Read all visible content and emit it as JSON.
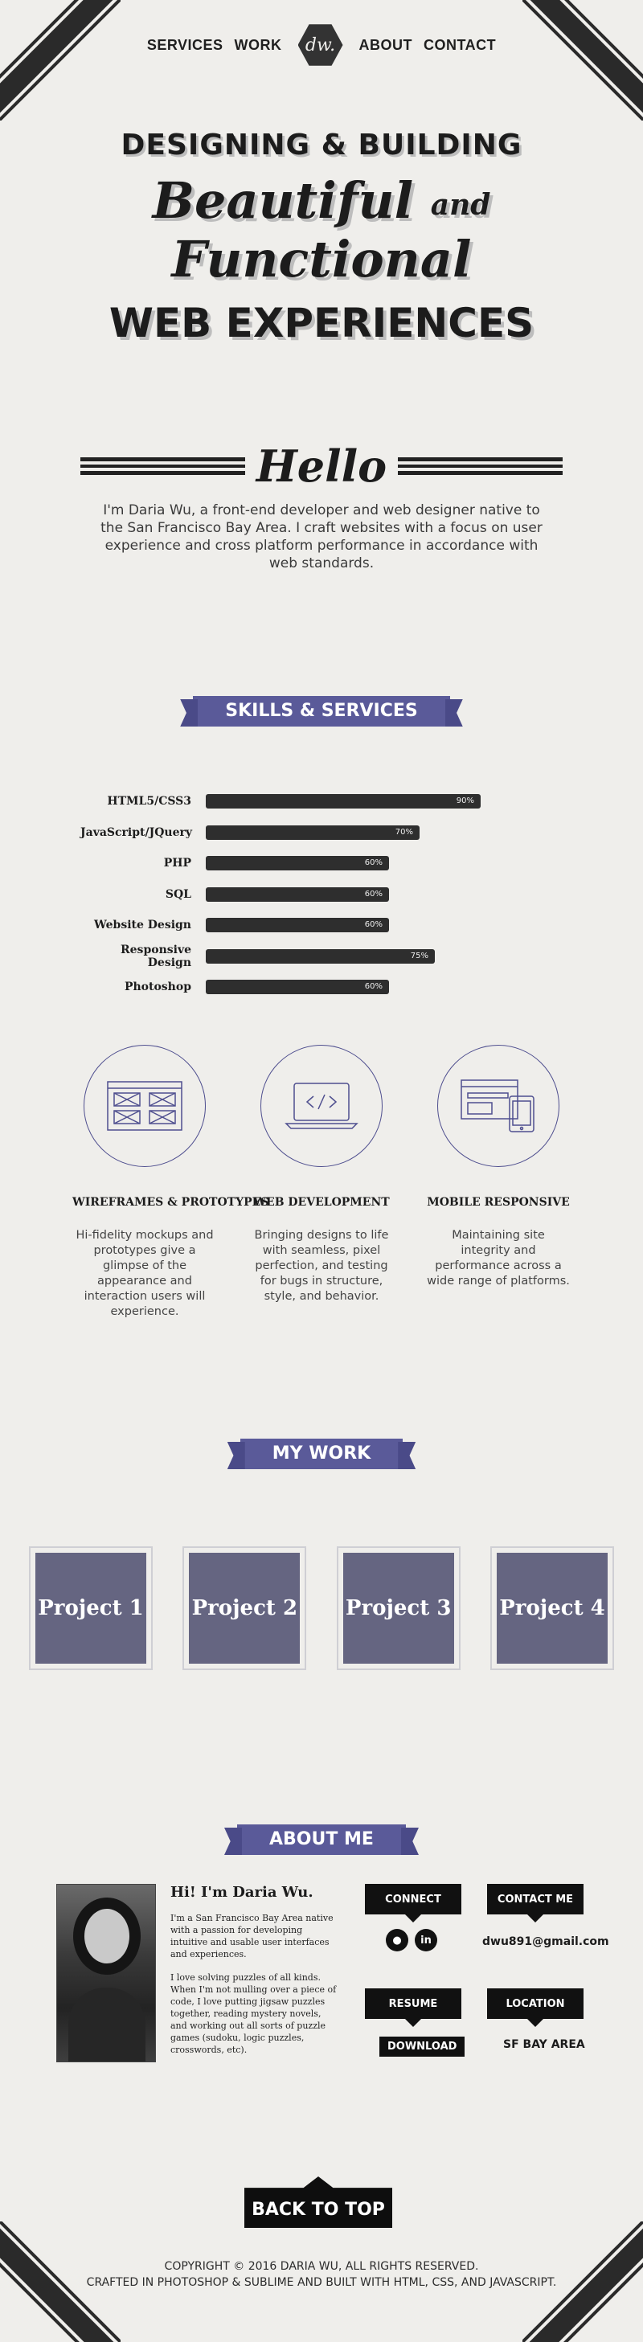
{
  "nav": {
    "items": [
      "SERVICES",
      "WORK",
      "ABOUT",
      "CONTACT"
    ],
    "logo_text": "dw."
  },
  "hero": {
    "line1": "DESIGNING & BUILDING",
    "line2_a": "Beautiful",
    "line2_and": "and",
    "line2_b": "Functional",
    "line3": "WEB EXPERIENCES"
  },
  "hello": {
    "title": "Hello",
    "text": "I'm Daria Wu, a front-end developer and web designer native to the San Francisco Bay Area. I craft websites with a focus on user experience and cross platform performance in accordance with web standards."
  },
  "skills": {
    "heading": "SKILLS & SERVICES",
    "items": [
      {
        "name": "HTML5/CSS3",
        "percent": 90,
        "label": "90%"
      },
      {
        "name": "JavaScript/JQuery",
        "percent": 70,
        "label": "70%"
      },
      {
        "name": "PHP",
        "percent": 60,
        "label": "60%"
      },
      {
        "name": "SQL",
        "percent": 60,
        "label": "60%"
      },
      {
        "name": "Website Design",
        "percent": 60,
        "label": "60%"
      },
      {
        "name": "Responsive Design",
        "percent": 75,
        "label": "75%"
      },
      {
        "name": "Photoshop",
        "percent": 60,
        "label": "60%"
      }
    ]
  },
  "services": [
    {
      "icon": "wireframe-icon",
      "title": "WIREFRAMES & PROTOTYPES",
      "text": "Hi-fidelity mockups and prototypes give a glimpse of the appearance and interaction users will experience."
    },
    {
      "icon": "code-laptop-icon",
      "title": "WEB DEVELOPMENT",
      "text": "Bringing designs to life with seamless, pixel perfection, and testing for bugs in structure, style, and behavior."
    },
    {
      "icon": "responsive-devices-icon",
      "title": "MOBILE RESPONSIVE",
      "text": "Maintaining site integrity and performance across a wide range of platforms."
    }
  ],
  "work": {
    "heading": "MY WORK",
    "projects": [
      "Project 1",
      "Project 2",
      "Project 3",
      "Project 4"
    ]
  },
  "about": {
    "heading": "ABOUT ME",
    "title": "Hi! I'm Daria Wu.",
    "p1": "I'm a San Francisco Bay Area native with a passion for developing intuitive and usable user interfaces and experiences.",
    "p2": "I love solving puzzles of all kinds. When I'm not mulling over a piece of code, I love putting jigsaw puzzles together, reading mystery novels, and working out all sorts of puzzle games (sudoku, logic puzzles, crosswords, etc).",
    "connect": "CONNECT",
    "contact": "CONTACT ME",
    "email": "dwu891@gmail.com",
    "resume": "RESUME",
    "download": "DOWNLOAD",
    "location": "LOCATION",
    "location_value": "SF BAY AREA",
    "social": [
      "github-icon",
      "linkedin-icon"
    ]
  },
  "back_to_top": "BACK TO TOP",
  "footer": {
    "line1": "COPYRIGHT © 2016 DARIA WU, ALL RIGHTS RESERVED.",
    "line2": "CRAFTED IN PHOTOSHOP & SUBLIME AND BUILT WITH HTML, CSS, AND JAVASCRIPT."
  },
  "colors": {
    "background": "#efeeeb",
    "accent": "#5a5a99",
    "project_tile": "#656581",
    "dark": "#111111"
  }
}
